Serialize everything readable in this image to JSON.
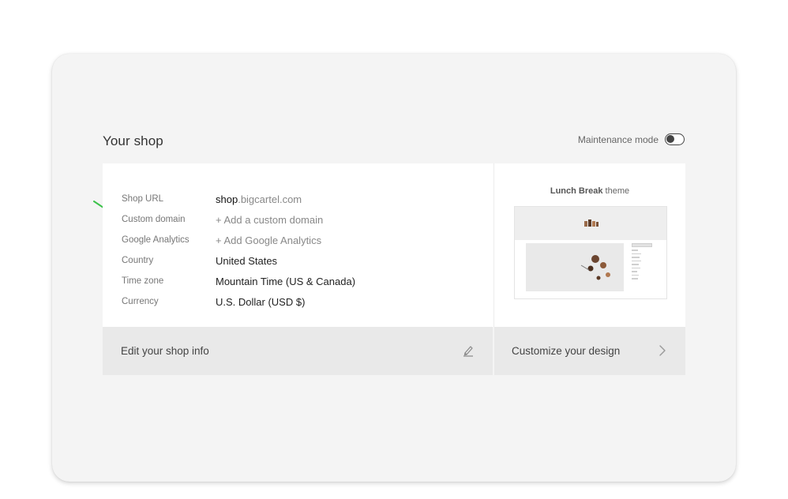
{
  "section": {
    "title": "Your shop",
    "maintenance_label": "Maintenance mode",
    "maintenance_on": false
  },
  "info_rows": [
    {
      "label": "Shop URL",
      "value_bold": "shop",
      "value_rest": ".bigcartel.com"
    },
    {
      "label": "Custom domain",
      "value": "+ Add a custom domain"
    },
    {
      "label": "Google Analytics",
      "value": "+ Add Google Analytics"
    },
    {
      "label": "Country",
      "value": "United States"
    },
    {
      "label": "Time zone",
      "value": "Mountain Time (US & Canada)"
    },
    {
      "label": "Currency",
      "value": "U.S. Dollar (USD $)"
    }
  ],
  "theme": {
    "name": "Lunch Break",
    "suffix": " theme"
  },
  "footer": {
    "edit_label": "Edit your shop info",
    "customize_label": "Customize your design"
  },
  "icons": {
    "edit": "pencil-icon",
    "customize": "chevron-right-icon",
    "annotation": "arrow-icon",
    "maintenance": "toggle-switch"
  },
  "colors": {
    "annotation_arrow": "#3cc24a",
    "background": "#f4f4f4",
    "card": "#ffffff",
    "footer": "#e9e9e9"
  }
}
